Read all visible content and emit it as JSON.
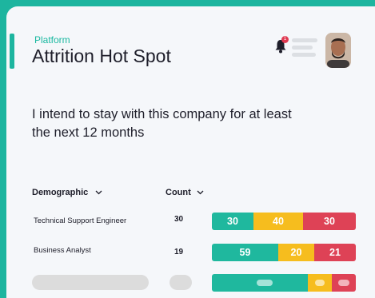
{
  "header": {
    "eyebrow": "Platform",
    "title": "Attrition Hot Spot",
    "notification_count": "1"
  },
  "question": "I intend to stay with this company for at least the next 12 months",
  "table": {
    "columns": [
      "Demographic",
      "Count"
    ],
    "rows": [
      {
        "label": "Technical Support Engineer",
        "count": "30",
        "segments": [
          "30",
          "40",
          "30"
        ]
      },
      {
        "label": "Business Analyst",
        "count": "19",
        "segments": [
          "59",
          "20",
          "21"
        ]
      }
    ]
  },
  "colors": {
    "favorable": "#1fb89e",
    "neutral": "#f6bd1e",
    "unfavorable": "#de4256",
    "brand": "#1db59f"
  },
  "icons": [
    "bell-icon",
    "menu-icon",
    "chevron-down-icon"
  ]
}
